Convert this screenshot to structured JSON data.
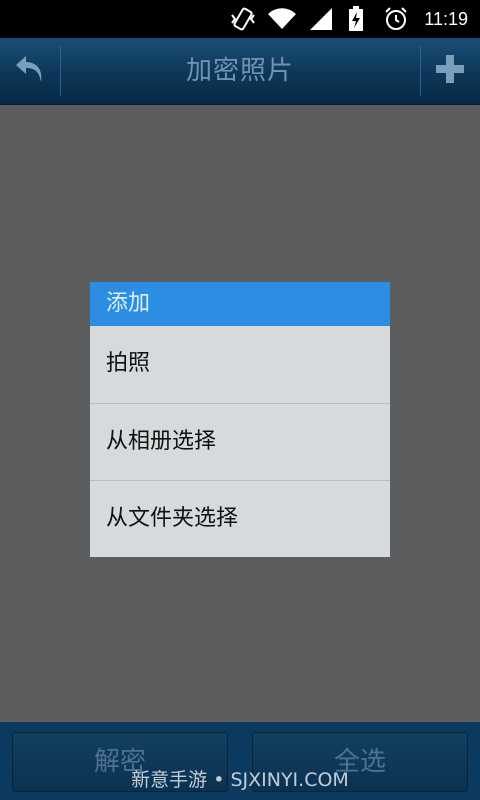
{
  "status_bar": {
    "time": "11:19",
    "icons": [
      "vibrate-icon",
      "wifi-icon",
      "signal-icon",
      "battery-charging-icon",
      "alarm-icon"
    ]
  },
  "title_bar": {
    "back_icon": "back-arrow-icon",
    "title": "加密照片",
    "add_icon": "plus-icon"
  },
  "dialog": {
    "title": "添加",
    "items": [
      {
        "label": "拍照"
      },
      {
        "label": "从相册选择"
      },
      {
        "label": "从文件夹选择"
      }
    ]
  },
  "bottom_bar": {
    "decrypt_label": "解密",
    "select_all_label": "全选"
  },
  "watermark": "新意手游 • SJXINYI.COM",
  "colors": {
    "dialog_header": "#2b8ee2",
    "title_bar": "#0c3658",
    "overlay": "#5c5d5f"
  }
}
